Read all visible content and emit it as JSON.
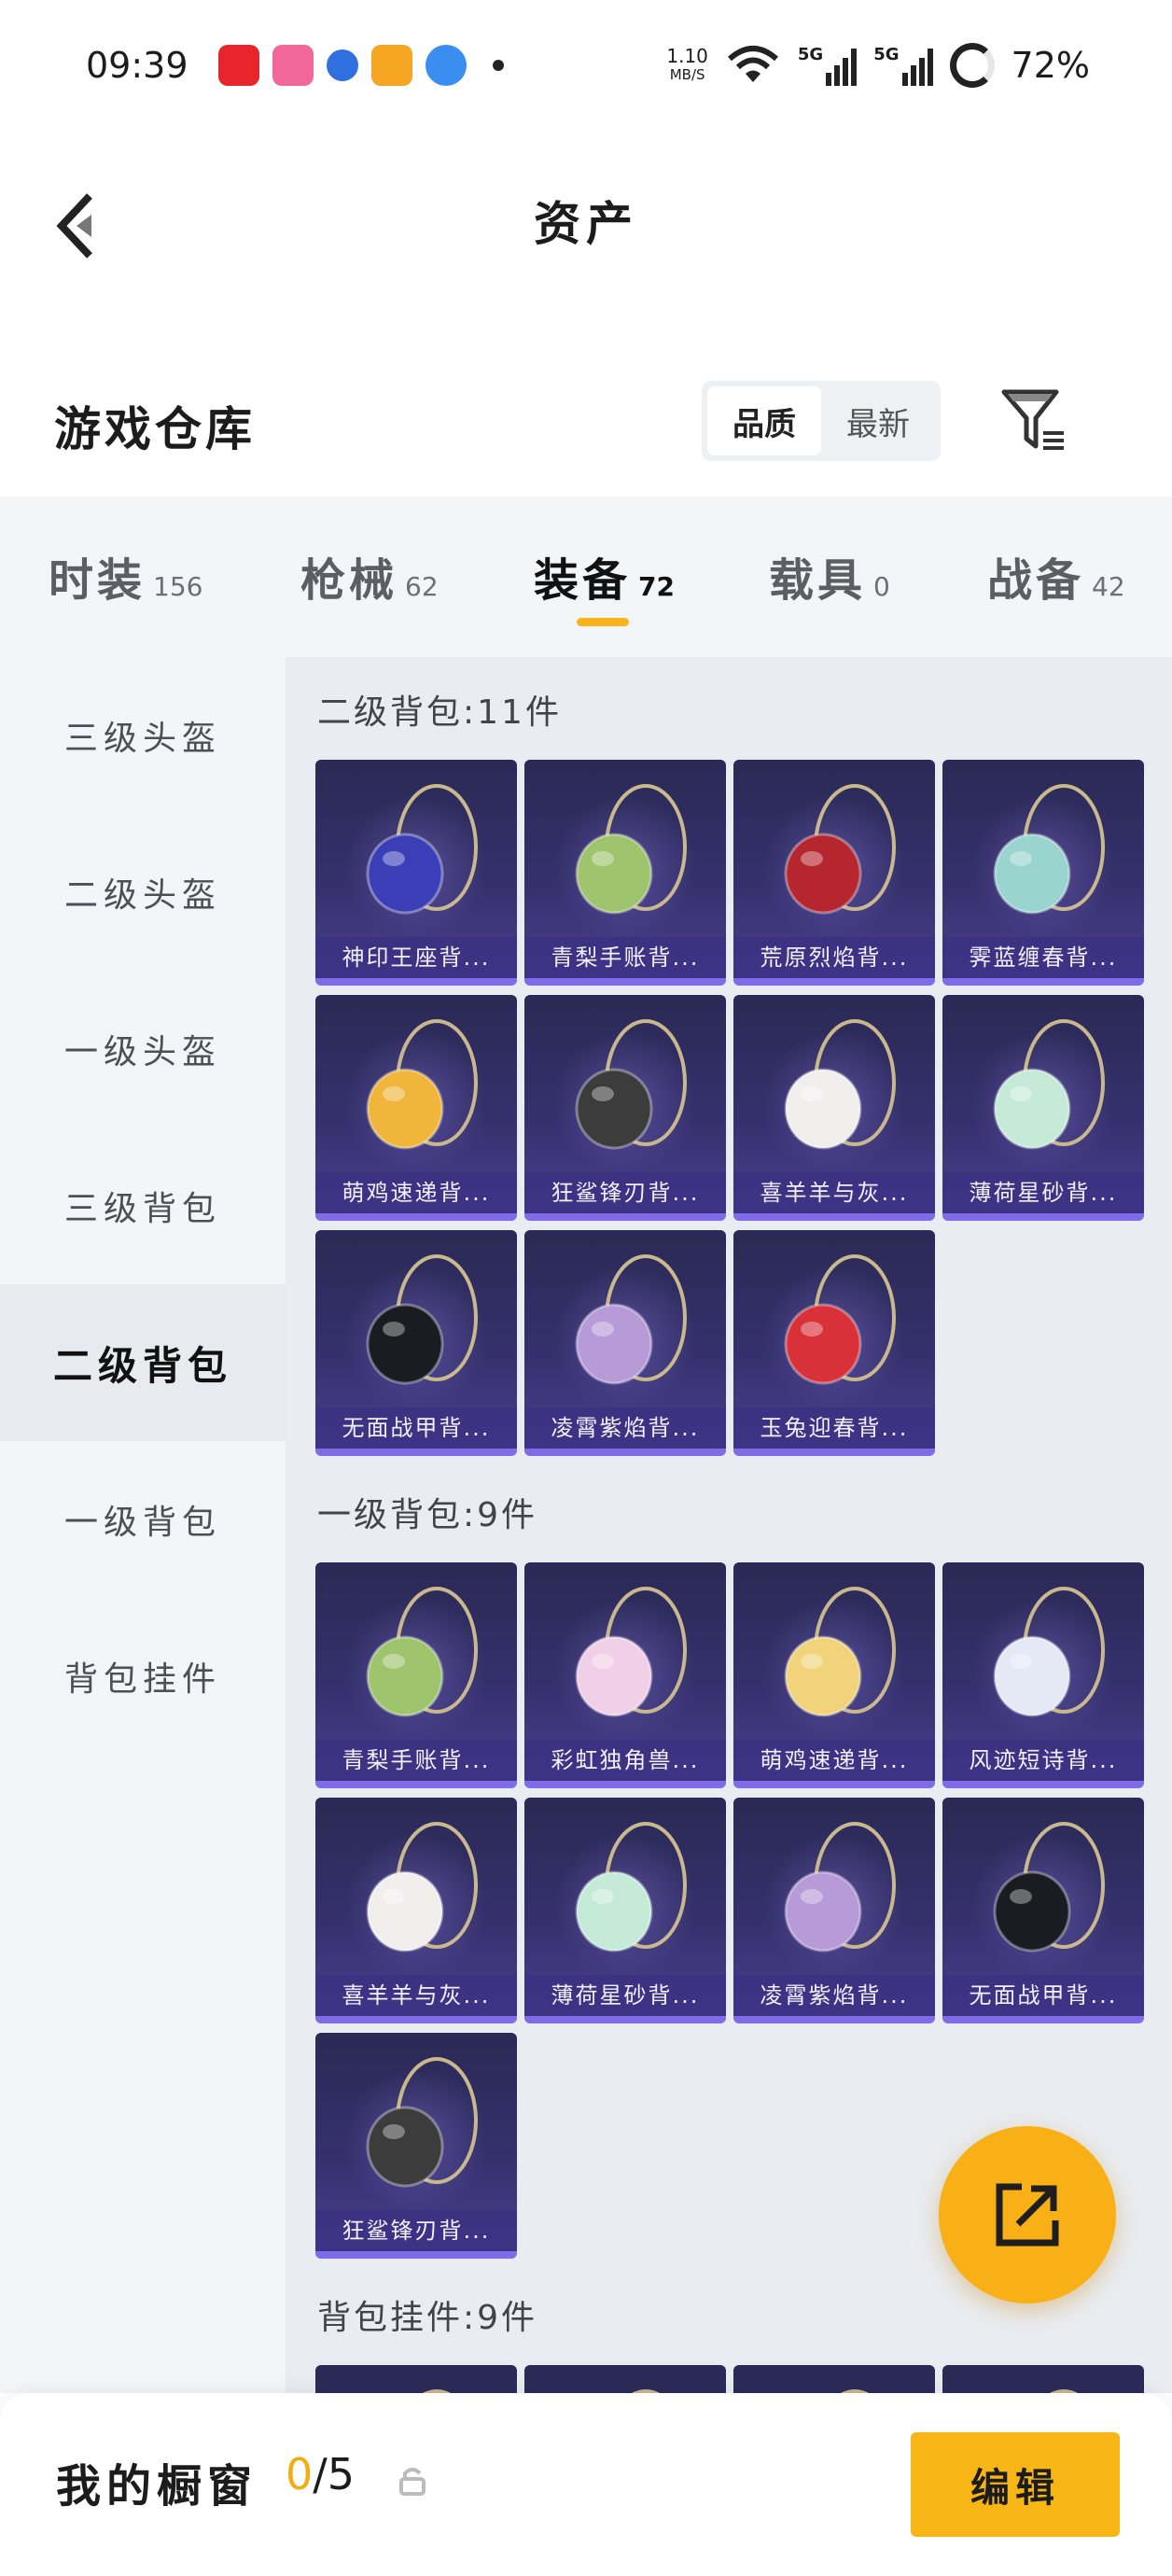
{
  "status_bar": {
    "time": "09:39",
    "net_speed": "1.10",
    "net_unit": "MB/S",
    "signal1": "5G",
    "signal2": "5G",
    "battery": "72%",
    "app_icon_colors": [
      "#e8242c",
      "#f2679a",
      "#2f6fe0",
      "#f6a623",
      "#3a8ef0"
    ]
  },
  "header": {
    "title": "资产"
  },
  "warehouse": {
    "title": "游戏仓库",
    "sort_options": [
      "品质",
      "最新"
    ],
    "active_sort": "品质"
  },
  "tabs": [
    {
      "label": "时装",
      "count": "156"
    },
    {
      "label": "枪械",
      "count": "62"
    },
    {
      "label": "装备",
      "count": "72"
    },
    {
      "label": "载具",
      "count": "0"
    },
    {
      "label": "战备",
      "count": "42"
    }
  ],
  "active_tab": "装备",
  "sidebar": {
    "items": [
      "三级头盔",
      "二级头盔",
      "一级头盔",
      "三级背包",
      "二级背包",
      "一级背包",
      "背包挂件"
    ],
    "active": "二级背包"
  },
  "sections": [
    {
      "title": "二级背包:11件",
      "items": [
        {
          "name": "神印王座背...",
          "icon": "royal-seal-backpack-icon",
          "color": "#3a3fb8"
        },
        {
          "name": "青梨手账背...",
          "icon": "green-pear-backpack-icon",
          "color": "#9fc46e"
        },
        {
          "name": "荒原烈焰背...",
          "icon": "wasteland-flame-backpack-icon",
          "color": "#b5262e"
        },
        {
          "name": "霁蓝缠春背...",
          "icon": "blue-spring-backpack-icon",
          "color": "#9ad4cf"
        },
        {
          "name": "萌鸡速递背...",
          "icon": "cute-chick-backpack-icon",
          "color": "#f0b63c"
        },
        {
          "name": "狂鲨锋刃背...",
          "icon": "shark-blade-backpack-icon",
          "color": "#3c3c3c"
        },
        {
          "name": "喜羊羊与灰...",
          "icon": "sheep-backpack-icon",
          "color": "#f1eeee"
        },
        {
          "name": "薄荷星砂背...",
          "icon": "mint-star-backpack-icon",
          "color": "#c6ead8"
        },
        {
          "name": "无面战甲背...",
          "icon": "faceless-armor-backpack-icon",
          "color": "#1b1c22"
        },
        {
          "name": "凌霄紫焰背...",
          "icon": "purple-flame-backpack-icon",
          "color": "#b79ad8"
        },
        {
          "name": "玉兔迎春背...",
          "icon": "jade-rabbit-backpack-icon",
          "color": "#d8313a"
        }
      ]
    },
    {
      "title": "一级背包:9件",
      "items": [
        {
          "name": "青梨手账背...",
          "icon": "green-pear-backpack-icon",
          "color": "#9fc46e"
        },
        {
          "name": "彩虹独角兽...",
          "icon": "rainbow-unicorn-backpack-icon",
          "color": "#f1cfe7"
        },
        {
          "name": "萌鸡速递背...",
          "icon": "cute-chick-backpack-icon",
          "color": "#f0d37a"
        },
        {
          "name": "风迹短诗背...",
          "icon": "wind-poem-backpack-icon",
          "color": "#e4e9f5"
        },
        {
          "name": "喜羊羊与灰...",
          "icon": "sheep-backpack-icon",
          "color": "#f1eeee"
        },
        {
          "name": "薄荷星砂背...",
          "icon": "mint-star-backpack-icon",
          "color": "#c6ead8"
        },
        {
          "name": "凌霄紫焰背...",
          "icon": "purple-flame-backpack-icon",
          "color": "#b79ad8"
        },
        {
          "name": "无面战甲背...",
          "icon": "faceless-armor-backpack-icon",
          "color": "#1b1c22"
        },
        {
          "name": "狂鲨锋刃背...",
          "icon": "shark-blade-backpack-icon",
          "color": "#3c3c3c"
        }
      ]
    },
    {
      "title": "背包挂件:9件",
      "items": [
        {
          "name": "",
          "icon": "pendant-icon",
          "color": "#3a3a70"
        },
        {
          "name": "",
          "icon": "pendant-icon",
          "color": "#3a3a70"
        },
        {
          "name": "",
          "icon": "pendant-icon",
          "color": "#3a3a70"
        },
        {
          "name": "",
          "icon": "pendant-icon",
          "color": "#3a3a70"
        }
      ]
    }
  ],
  "bottom_bar": {
    "label": "我的橱窗",
    "current": "0",
    "total": "/5",
    "edit_label": "编辑"
  },
  "colors": {
    "accent": "#f8b616",
    "card_caption": "#3c3082",
    "card_border": "#7f6ce6"
  }
}
